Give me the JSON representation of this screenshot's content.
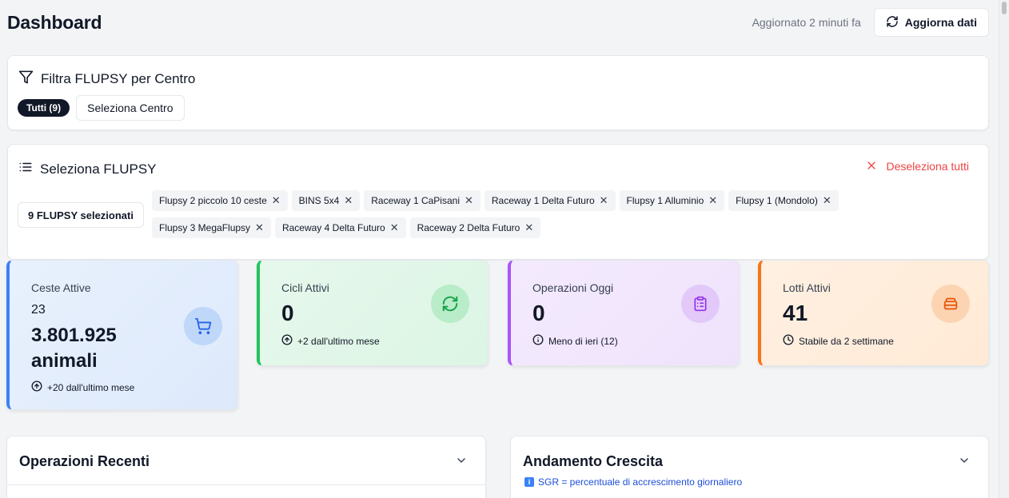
{
  "header": {
    "title": "Dashboard",
    "updated": "Aggiornato 2 minuti fa",
    "refresh_label": "Aggiorna dati"
  },
  "center_filter": {
    "title": "Filtra FLUPSY per Centro",
    "all_label": "Tutti (9)",
    "select_center_label": "Seleziona Centro"
  },
  "flupsy_select": {
    "title": "Seleziona FLUPSY",
    "deselect_label": "Deseleziona tutti",
    "selected_count": "9 FLUPSY selezionati",
    "chips": [
      "Flupsy 2 piccolo 10 ceste",
      "BINS 5x4",
      "Raceway 1 CaPisani",
      "Raceway 1 Delta Futuro",
      "Flupsy 1 Alluminio",
      "Flupsy 1 (Mondolo)",
      "Flupsy 3 MegaFlupsy",
      "Raceway 4 Delta Futuro",
      "Raceway 2 Delta Futuro"
    ]
  },
  "stats": {
    "ceste": {
      "label": "Ceste Attive",
      "count": "23",
      "animals": "3.801.925 animali",
      "trend": "+20 dall'ultimo mese",
      "color": "#3b82f6"
    },
    "cicli": {
      "label": "Cicli Attivi",
      "value": "0",
      "trend": "+2 dall'ultimo mese",
      "color": "#22c55e"
    },
    "operazioni": {
      "label": "Operazioni Oggi",
      "value": "0",
      "trend": "Meno di ieri (12)",
      "color": "#a855f7"
    },
    "lotti": {
      "label": "Lotti Attivi",
      "value": "41",
      "trend": "Stabile da 2 settimane",
      "color": "#f97316"
    }
  },
  "panels": {
    "recent_ops": {
      "title": "Operazioni Recenti"
    },
    "growth": {
      "title": "Andamento Crescita",
      "note": "SGR = percentuale di accrescimento giornaliero"
    }
  }
}
